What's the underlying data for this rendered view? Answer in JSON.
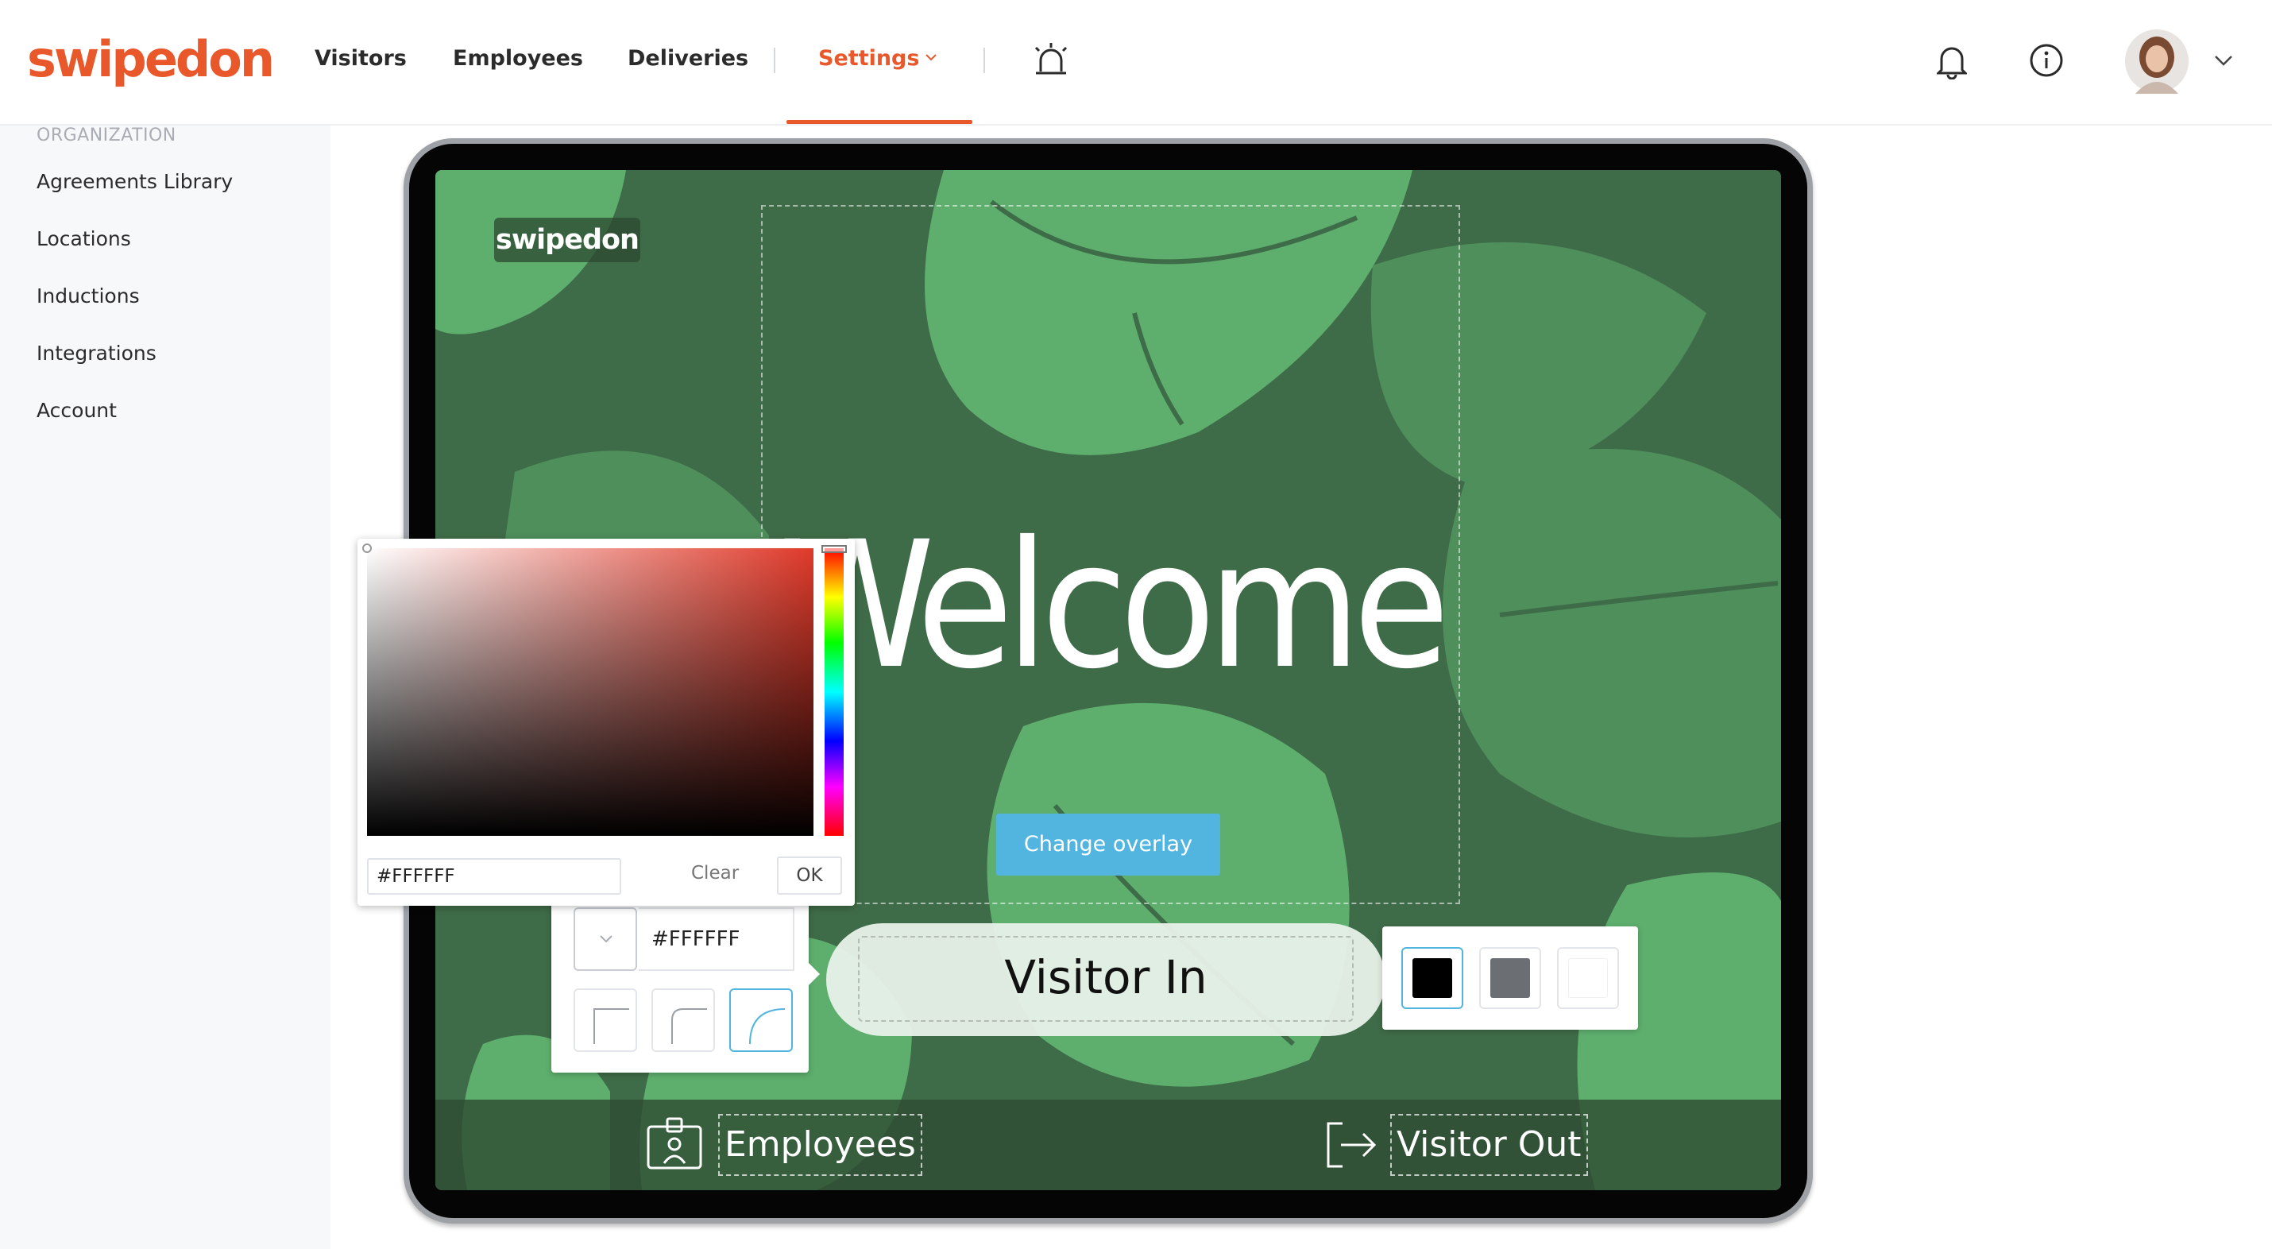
{
  "brand": {
    "logo_text": "swipedon",
    "accent": "#e8582b"
  },
  "nav": {
    "items": [
      {
        "label": "Visitors"
      },
      {
        "label": "Employees"
      },
      {
        "label": "Deliveries"
      },
      {
        "label": "Settings",
        "active": true
      }
    ],
    "icons": [
      "alarm-icon",
      "bell-icon",
      "info-icon",
      "avatar",
      "chevron-down-icon"
    ]
  },
  "sidebar": {
    "heading": "ORGANIZATION",
    "items": [
      {
        "label": "Agreements Library"
      },
      {
        "label": "Locations"
      },
      {
        "label": "Inductions"
      },
      {
        "label": "Integrations"
      },
      {
        "label": "Account"
      }
    ]
  },
  "preview": {
    "logo_text": "swipedon",
    "welcome_text": "Welcome",
    "overlay_button": "Change overlay",
    "visitor_in_label": "Visitor In",
    "employees_label": "Employees",
    "visitor_out_label": "Visitor Out",
    "background_color": "#3f6c48",
    "overlay_button_color": "#51b5e0"
  },
  "color_picker": {
    "input_value": "#FFFFFF",
    "clear_label": "Clear",
    "ok_label": "OK"
  },
  "style_popover": {
    "hex_value": "#FFFFFF",
    "corner_options": [
      "square",
      "rounded",
      "round"
    ],
    "selected_corner": "round"
  },
  "text_color_popover": {
    "options": [
      "#000000",
      "#6b6f73",
      "#ffffff"
    ],
    "selected": "#000000"
  }
}
